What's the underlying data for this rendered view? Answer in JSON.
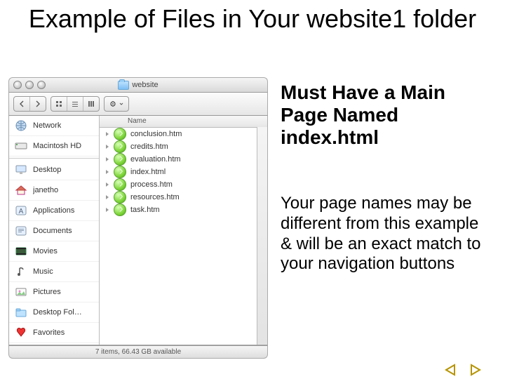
{
  "slide": {
    "title": "Example of Files in Your website1 folder",
    "emphasis": "Must Have a Main Page Named index.html",
    "body": "Your page names may be different from this example & will be an exact match to your navigation buttons"
  },
  "finder": {
    "window_title": "website",
    "sidebar": [
      {
        "icon": "network",
        "label": "Network"
      },
      {
        "icon": "hd",
        "label": "Macintosh HD"
      },
      {
        "icon": "desktop",
        "label": "Desktop"
      },
      {
        "icon": "home",
        "label": "janetho"
      },
      {
        "icon": "apps",
        "label": "Applications"
      },
      {
        "icon": "docs",
        "label": "Documents"
      },
      {
        "icon": "movies",
        "label": "Movies"
      },
      {
        "icon": "music",
        "label": "Music"
      },
      {
        "icon": "pictures",
        "label": "Pictures"
      },
      {
        "icon": "desktopfol",
        "label": "Desktop Fol…"
      },
      {
        "icon": "favorites",
        "label": "Favorites"
      }
    ],
    "column_header": "Name",
    "files": [
      "conclusion.htm",
      "credits.htm",
      "evaluation.htm",
      "index.html",
      "process.htm",
      "resources.htm",
      "task.htm"
    ],
    "status": "7 items, 66.43 GB available"
  },
  "nav": {
    "prev": "prev",
    "next": "next"
  }
}
